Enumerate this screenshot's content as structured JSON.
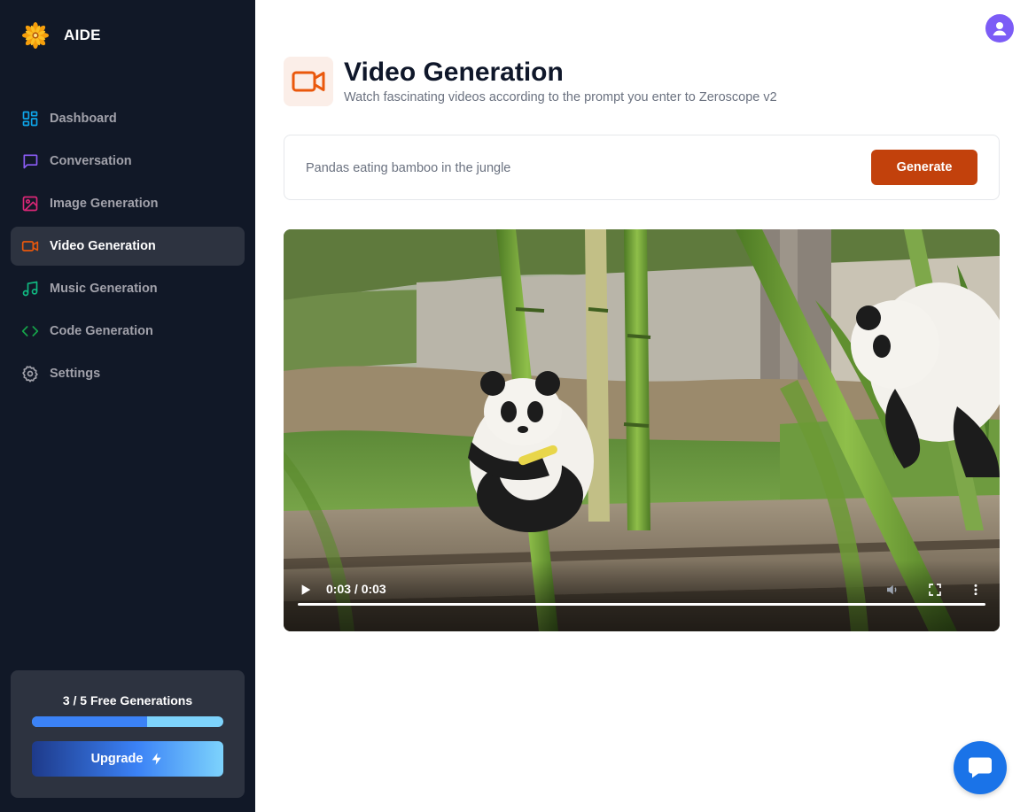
{
  "brand": {
    "name": "AIDE",
    "logo_icon": "sun-flower-logo"
  },
  "sidebar": {
    "items": [
      {
        "label": "Dashboard",
        "icon": "dashboard-icon",
        "color": "#0ea5e9",
        "active": false
      },
      {
        "label": "Conversation",
        "icon": "message-icon",
        "color": "#8b5cf6",
        "active": false
      },
      {
        "label": "Image Generation",
        "icon": "image-icon",
        "color": "#db2777",
        "active": false
      },
      {
        "label": "Video Generation",
        "icon": "video-icon",
        "color": "#ea580c",
        "active": true
      },
      {
        "label": "Music Generation",
        "icon": "music-icon",
        "color": "#10b981",
        "active": false
      },
      {
        "label": "Code Generation",
        "icon": "code-icon",
        "color": "#16a34a",
        "active": false
      },
      {
        "label": "Settings",
        "icon": "gear-icon",
        "color": "#a1a1aa",
        "active": false
      }
    ]
  },
  "free_tier": {
    "text": "3 / 5 Free Generations",
    "used": 3,
    "total": 5,
    "upgrade_label": "Upgrade"
  },
  "header": {
    "title": "Video Generation",
    "subtitle": "Watch fascinating videos according to the prompt you enter to Zeroscope v2",
    "icon": "video-icon",
    "accent_color": "#ea580c"
  },
  "prompt": {
    "value": "Pandas eating bamboo in the jungle",
    "button_label": "Generate"
  },
  "video": {
    "time_display": "0:03 / 0:03",
    "progress": 1.0
  },
  "colors": {
    "sidebar_bg": "#111827",
    "generate_button": "#c2410c",
    "avatar": "#7c5cf6",
    "chat_fab": "#1a73e8"
  }
}
